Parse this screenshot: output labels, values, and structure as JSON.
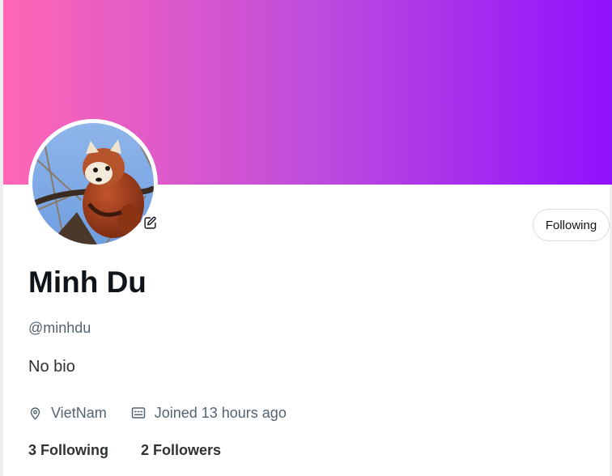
{
  "profile": {
    "banner_gradient": [
      "#ff67b4",
      "#c04ddc",
      "#8f12fd"
    ],
    "avatar_icon": "red-panda-photo",
    "edit_icon": "edit-pencil-square-icon",
    "follow_button_label": "Following",
    "name": "Minh Du",
    "handle": "@minhdu",
    "bio": "No bio",
    "location_icon": "map-pin-icon",
    "location": "VietNam",
    "joined_icon": "calendar-id-card-icon",
    "joined": "Joined 13 hours ago",
    "following_count": "3",
    "following_label": "Following",
    "followers_count": "2",
    "followers_label": "Followers"
  }
}
